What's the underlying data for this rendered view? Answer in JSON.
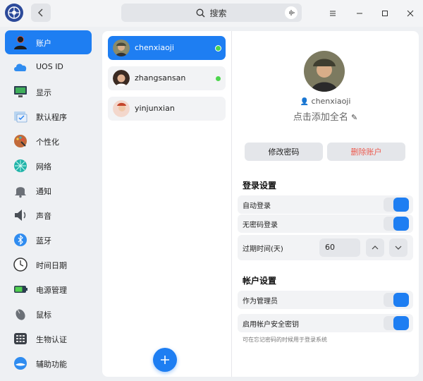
{
  "search": {
    "placeholder": "搜索"
  },
  "sidebar": {
    "items": [
      {
        "label": "账户",
        "icon": "account-icon",
        "active": true
      },
      {
        "label": "UOS ID",
        "icon": "cloud-icon"
      },
      {
        "label": "显示",
        "icon": "monitor-icon"
      },
      {
        "label": "默认程序",
        "icon": "default-apps-icon"
      },
      {
        "label": "个性化",
        "icon": "palette-icon"
      },
      {
        "label": "网络",
        "icon": "network-icon"
      },
      {
        "label": "通知",
        "icon": "bell-icon"
      },
      {
        "label": "声音",
        "icon": "speaker-icon"
      },
      {
        "label": "蓝牙",
        "icon": "bluetooth-icon"
      },
      {
        "label": "时间日期",
        "icon": "clock-icon"
      },
      {
        "label": "电源管理",
        "icon": "battery-icon"
      },
      {
        "label": "鼠标",
        "icon": "mouse-icon"
      },
      {
        "label": "生物认证",
        "icon": "biometric-icon"
      },
      {
        "label": "辅助功能",
        "icon": "accessibility-icon"
      }
    ]
  },
  "users": [
    {
      "name": "chenxiaoji",
      "online": true,
      "active": true
    },
    {
      "name": "zhangsansan",
      "online": true
    },
    {
      "name": "yinjunxian",
      "online": false
    }
  ],
  "detail": {
    "username": "chenxiaoji",
    "fullname_prompt": "点击添加全名",
    "change_password": "修改密码",
    "delete_account": "删除账户",
    "login_section": "登录设置",
    "auto_login": "自动登录",
    "passwordless_login": "无密码登录",
    "expiry_label": "过期时间(天)",
    "expiry_value": "60",
    "account_section": "帐户设置",
    "as_admin": "作为管理员",
    "security_key": "启用帐户安全密钥",
    "security_key_hint": "可在忘记密码的时候用于登录系统"
  },
  "colors": {
    "accent": "#1e7ef2",
    "danger": "#ec5b4f",
    "online": "#4dd54d"
  }
}
